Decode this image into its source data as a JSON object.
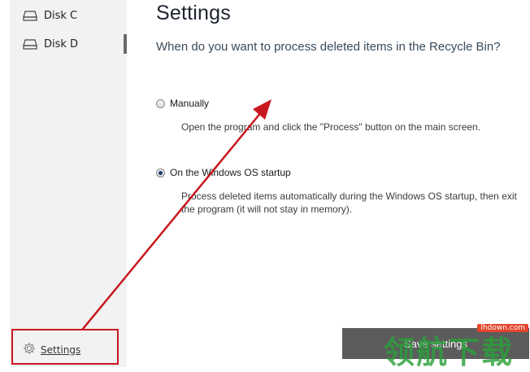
{
  "sidebar": {
    "items": [
      {
        "label": "Disk C",
        "icon": "drive-icon"
      },
      {
        "label": "Disk D",
        "icon": "drive-icon",
        "active": true
      }
    ],
    "settings_label": "Settings",
    "settings_icon": "gear-icon"
  },
  "main": {
    "title": "Settings",
    "question": "When do you want to process deleted items in the Recycle Bin?",
    "options": [
      {
        "label": "Manually",
        "description": "Open the program and click the \"Process\" button on the main screen.",
        "checked": false
      },
      {
        "label": "On the Windows OS startup",
        "description": "Process deleted items automatically during the Windows OS startup, then exit the program (it will not stay in memory).",
        "checked": true
      }
    ],
    "save_label": "Save settings"
  },
  "annotation": {
    "color": "#c8171e"
  },
  "watermark": {
    "text": "领航下载",
    "url": "lhdown.com"
  }
}
